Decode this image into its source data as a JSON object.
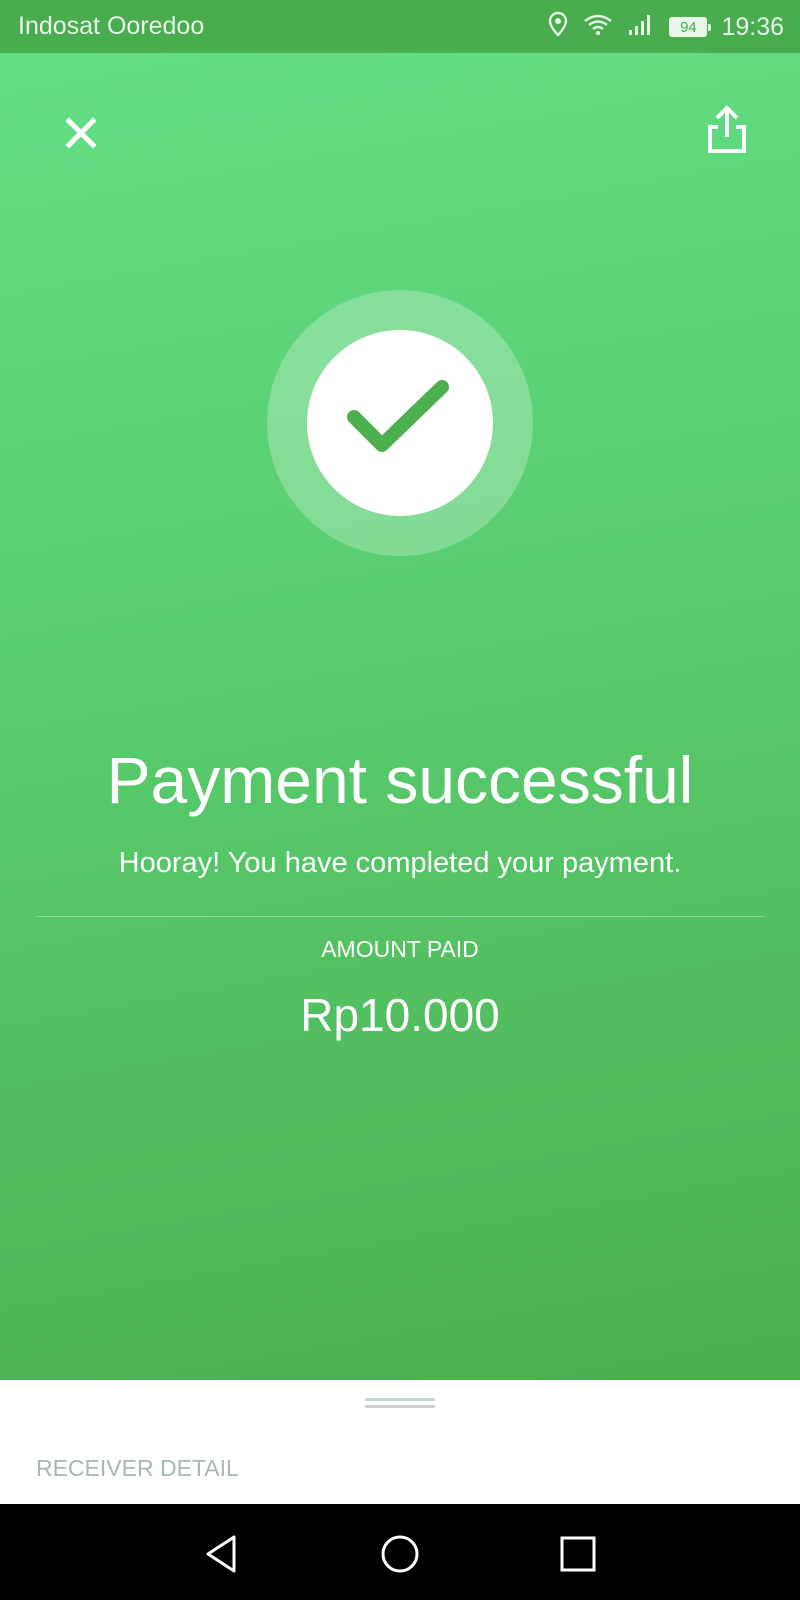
{
  "status_bar": {
    "carrier": "Indosat Ooredoo",
    "battery": "94",
    "time": "19:36",
    "icons": [
      "location-icon",
      "wifi-icon",
      "signal-icon",
      "battery-icon"
    ]
  },
  "header": {
    "close_icon": "close-icon",
    "share_icon": "share-icon"
  },
  "result": {
    "icon": "checkmark-icon",
    "title": "Payment successful",
    "subtitle": "Hooray! You have completed your payment."
  },
  "amount": {
    "label": "AMOUNT PAID",
    "value": "Rp10.000"
  },
  "sheet": {
    "receiver_label": "RECEIVER DETAIL"
  },
  "nav": {
    "back_icon": "back-icon",
    "home_icon": "home-icon",
    "recents_icon": "recents-icon"
  },
  "colors": {
    "green_top": "#64de85",
    "green_bottom": "#4caf50",
    "check_green": "#4caf50",
    "status_bar": "#49ad4f"
  }
}
